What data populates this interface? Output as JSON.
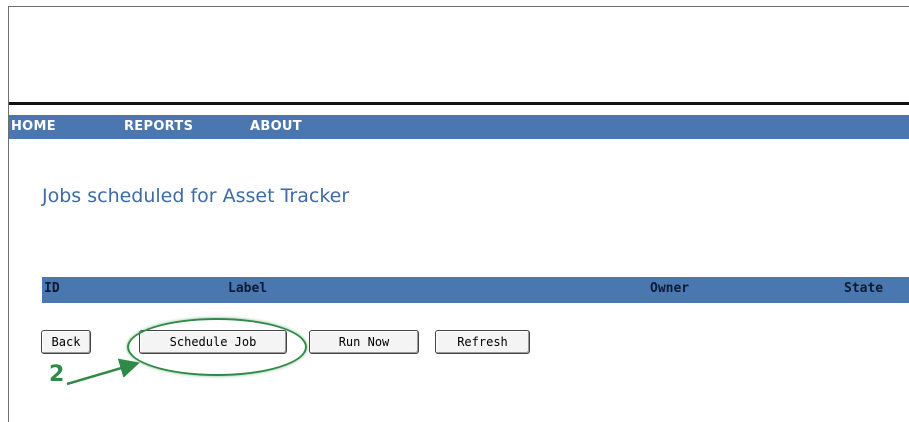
{
  "nav": {
    "items": [
      "HOME",
      "REPORTS",
      "ABOUT"
    ]
  },
  "page": {
    "title": "Jobs scheduled for Asset Tracker"
  },
  "table": {
    "columns": [
      "ID",
      "Label",
      "Owner",
      "State"
    ]
  },
  "buttons": {
    "back": "Back",
    "schedule_job": "Schedule Job",
    "run_now": "Run Now",
    "refresh": "Refresh"
  },
  "annotation": {
    "step": "2",
    "color": "#2f8a47"
  },
  "colors": {
    "nav_bg": "#4a77b0",
    "title": "#3e6aa6"
  }
}
